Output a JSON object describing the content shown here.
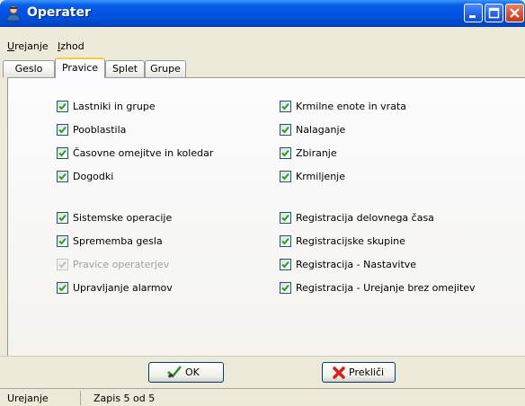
{
  "window": {
    "title": "Operater"
  },
  "menu": [
    {
      "label": "Urejanje"
    },
    {
      "label": "Izhod"
    }
  ],
  "tabs": [
    {
      "label": "Geslo",
      "active": false
    },
    {
      "label": "Pravice",
      "active": true
    },
    {
      "label": "Splet",
      "active": false
    },
    {
      "label": "Grupe",
      "active": false
    }
  ],
  "permissions": {
    "left_group1": [
      {
        "label": "Lastniki in grupe",
        "checked": true,
        "enabled": true
      },
      {
        "label": "Pooblastila",
        "checked": true,
        "enabled": true
      },
      {
        "label": "Časovne omejitve in koledar",
        "checked": true,
        "enabled": true
      },
      {
        "label": "Dogodki",
        "checked": true,
        "enabled": true
      }
    ],
    "left_group2": [
      {
        "label": "Sistemske operacije",
        "checked": true,
        "enabled": true
      },
      {
        "label": "Sprememba gesla",
        "checked": true,
        "enabled": true
      },
      {
        "label": "Pravice operaterjev",
        "checked": true,
        "enabled": false
      },
      {
        "label": "Upravljanje alarmov",
        "checked": true,
        "enabled": true
      }
    ],
    "right_group1": [
      {
        "label": "Krmilne enote in vrata",
        "checked": true,
        "enabled": true
      },
      {
        "label": "Nalaganje",
        "checked": true,
        "enabled": true
      },
      {
        "label": "Zbiranje",
        "checked": true,
        "enabled": true
      },
      {
        "label": "Krmiljenje",
        "checked": true,
        "enabled": true
      }
    ],
    "right_group2": [
      {
        "label": "Registracija delovnega časa",
        "checked": true,
        "enabled": true
      },
      {
        "label": "Registracijske skupine",
        "checked": true,
        "enabled": true
      },
      {
        "label": "Registracija - Nastavitve",
        "checked": true,
        "enabled": true
      },
      {
        "label": "Registracija - Urejanje brez omejitev",
        "checked": true,
        "enabled": true
      }
    ]
  },
  "buttons": {
    "ok": {
      "label": "OK",
      "icon": "checkmark-icon"
    },
    "cancel": {
      "label": "Prekliči",
      "icon": "red-x-icon"
    }
  },
  "status": {
    "mode": "Urejanje",
    "record": "Zapis 5 od 5"
  },
  "colors": {
    "titlebar": "#0054e3",
    "tab_highlight": "#ffc83c",
    "check": "#21a121"
  }
}
